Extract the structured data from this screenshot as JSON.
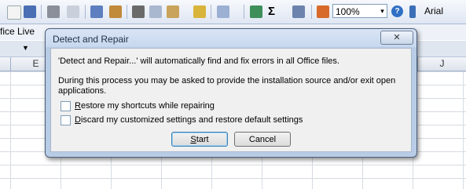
{
  "toolbar": {
    "zoom_value": "100%",
    "zoom_arrow": "▾",
    "help_glyph": "?",
    "font_name": "Arial",
    "sigma_glyph": "Σ",
    "icons": [
      "new-icon",
      "save-icon",
      "print-icon",
      "print-preview-icon",
      "spelling-icon",
      "research-icon",
      "cut-icon",
      "copy-icon",
      "paste-icon",
      "format-painter-icon",
      "undo-icon",
      "hyperlink-icon",
      "autosum-icon",
      "sort-ascending-icon",
      "chart-wizard-icon"
    ]
  },
  "office_bar": {
    "label": "fice Live",
    "dropdown": "▼"
  },
  "columns": {
    "partial_left": "E",
    "last": "J"
  },
  "dialog": {
    "title": "Detect and Repair",
    "close_glyph": "☒",
    "line1": "'Detect and Repair...'  will automatically find and fix errors in all Office files.",
    "line2a": "During this process you may be asked to provide the installation source and/or exit open",
    "line2b": "applications.",
    "option1_mnemonic": "R",
    "option1_rest": "estore my shortcuts while repairing",
    "option2_mnemonic": "D",
    "option2_rest": "iscard my customized settings and restore default settings",
    "start_mnemonic": "S",
    "start_rest": "tart",
    "cancel_label": "Cancel"
  }
}
